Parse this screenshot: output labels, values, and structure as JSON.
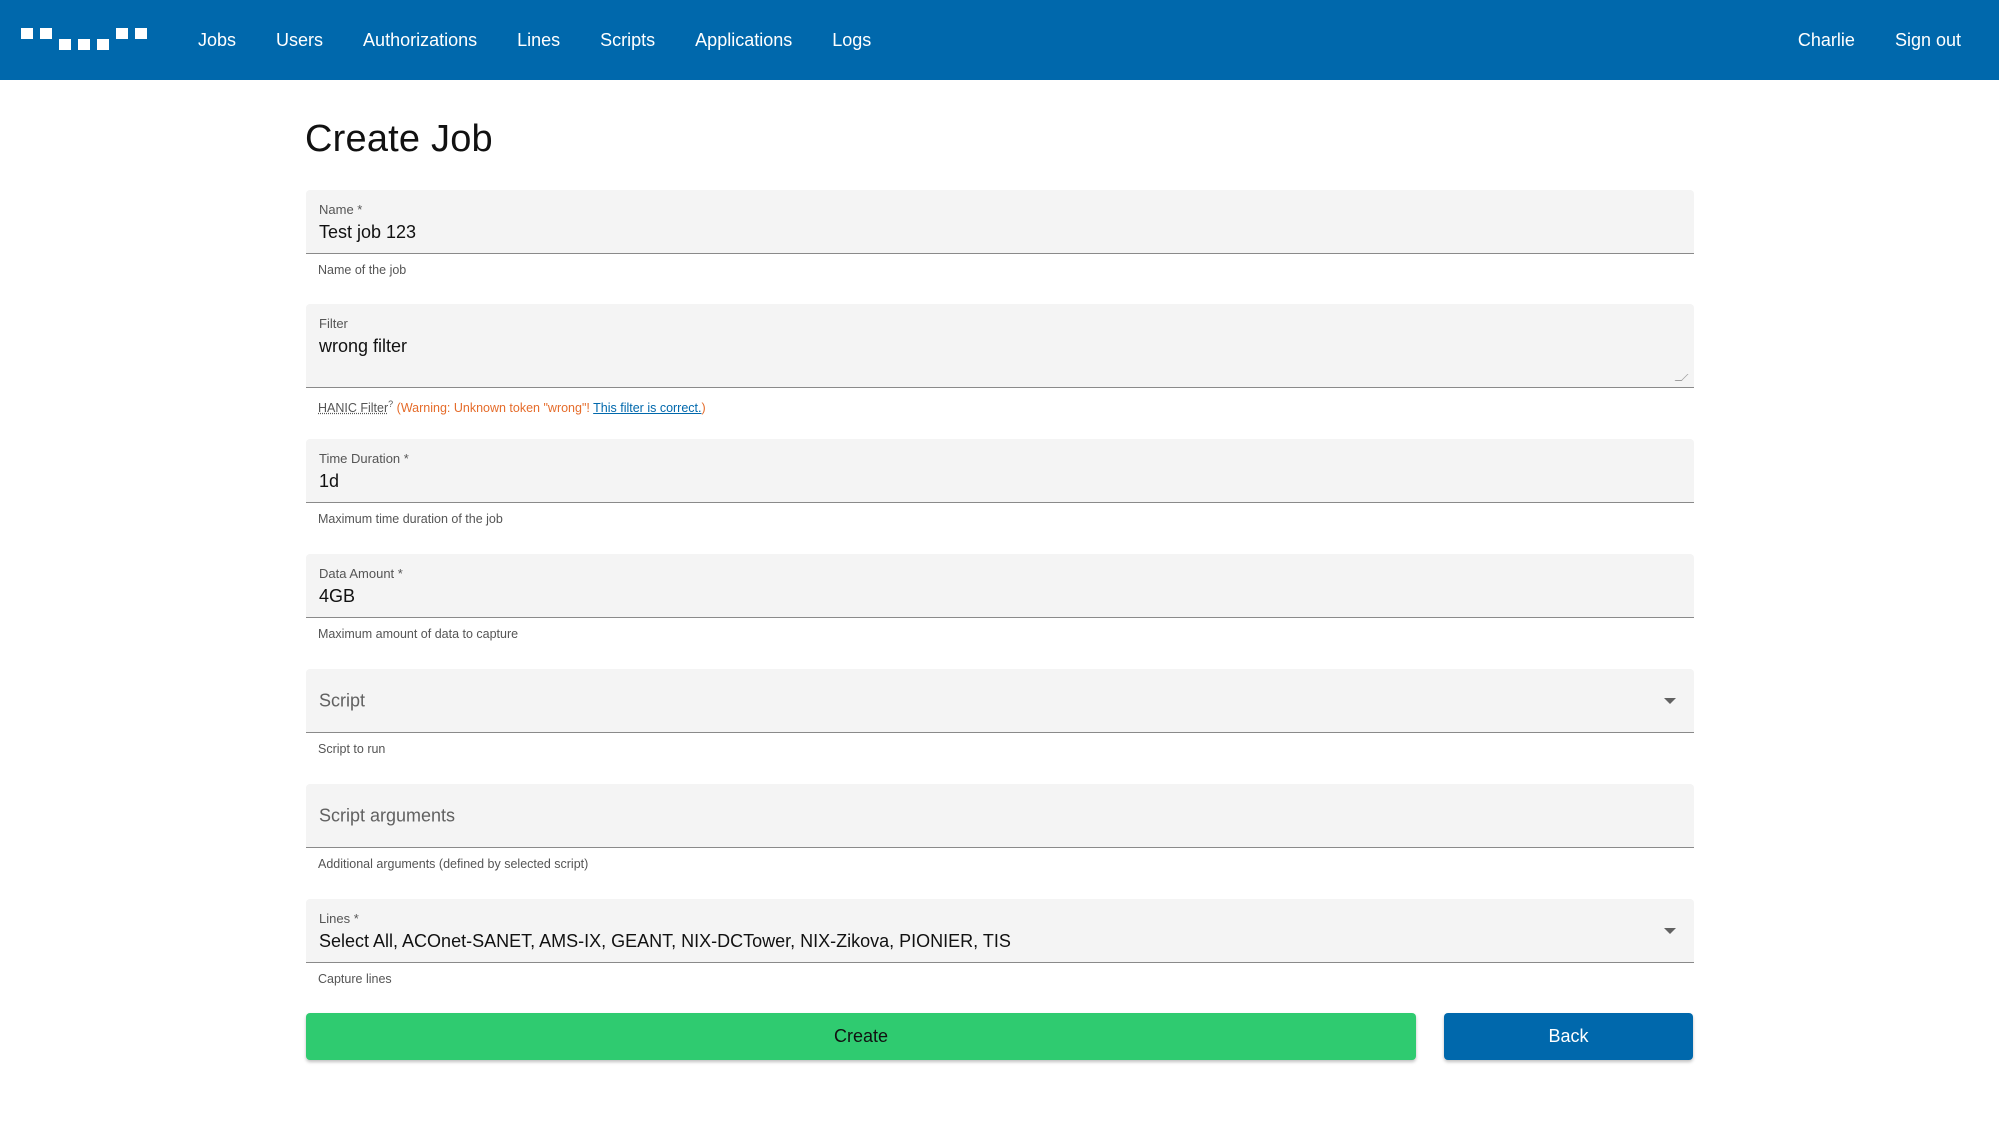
{
  "navbar": {
    "links": [
      "Jobs",
      "Users",
      "Authorizations",
      "Lines",
      "Scripts",
      "Applications",
      "Logs"
    ],
    "user": "Charlie",
    "sign_out": "Sign out",
    "background_color": "#0068ac"
  },
  "page": {
    "title": "Create Job"
  },
  "form": {
    "name": {
      "label": "Name *",
      "value": "Test job 123",
      "helper": "Name of the job"
    },
    "filter": {
      "label": "Filter",
      "value": "wrong filter",
      "helper_link": "HANIC Filter",
      "helper_sup": "?",
      "warning": "(Warning: Unknown token \"wrong\"!",
      "correct_link": "This filter is correct.",
      "close_paren": ")"
    },
    "time_duration": {
      "label": "Time Duration *",
      "value": "1d",
      "helper": "Maximum time duration of the job"
    },
    "data_amount": {
      "label": "Data Amount *",
      "value": "4GB",
      "helper": "Maximum amount of data to capture"
    },
    "script": {
      "placeholder": "Script",
      "helper": "Script to run"
    },
    "script_arguments": {
      "placeholder": "Script arguments",
      "helper": "Additional arguments (defined by selected script)"
    },
    "lines": {
      "label": "Lines *",
      "value": "Select All, ACOnet-SANET, AMS-IX, GEANT, NIX-DCTower, NIX-Zikova, PIONIER, TIS",
      "helper": "Capture lines"
    }
  },
  "buttons": {
    "create": "Create",
    "back": "Back",
    "create_color": "#2fcb70",
    "back_color": "#0068ac"
  }
}
